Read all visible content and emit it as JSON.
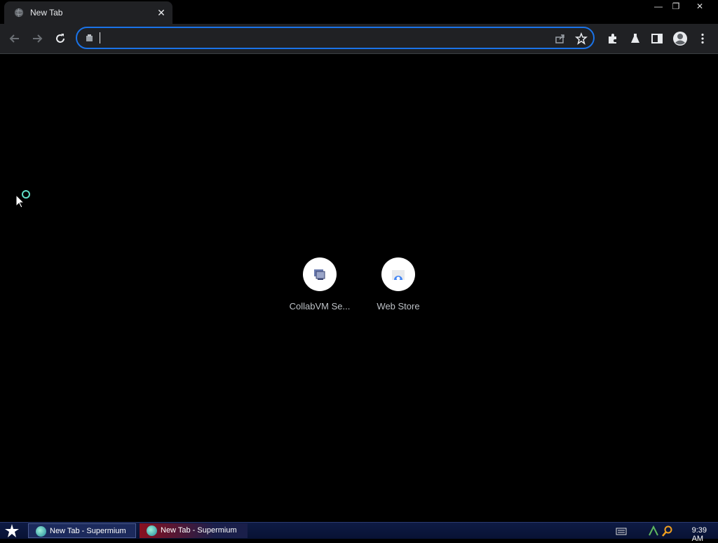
{
  "tab": {
    "title": "New Tab",
    "close": "✕"
  },
  "window_controls": {
    "minimize": "—",
    "restore": "❐",
    "close": "✕"
  },
  "omnibox": {
    "value": "",
    "placeholder": ""
  },
  "shortcuts": [
    {
      "label": "CollabVM Se..."
    },
    {
      "label": "Web Store"
    }
  ],
  "taskbar": {
    "tasks": [
      {
        "label": "New Tab - Supermium"
      },
      {
        "label": "New Tab - Supermium"
      }
    ],
    "clock": "9:39 AM"
  },
  "colors": {
    "accent": "#1a73e8",
    "toolbar": "#202124",
    "background": "#000000",
    "taskbar": "#0e1b44"
  },
  "icons": [
    "globe-icon",
    "close-icon",
    "back-arrow-icon",
    "forward-arrow-icon",
    "reload-icon",
    "site-info-icon",
    "share-icon",
    "star-icon",
    "extensions-icon",
    "labs-icon",
    "sidepanel-icon",
    "profile-icon",
    "menu-icon"
  ]
}
